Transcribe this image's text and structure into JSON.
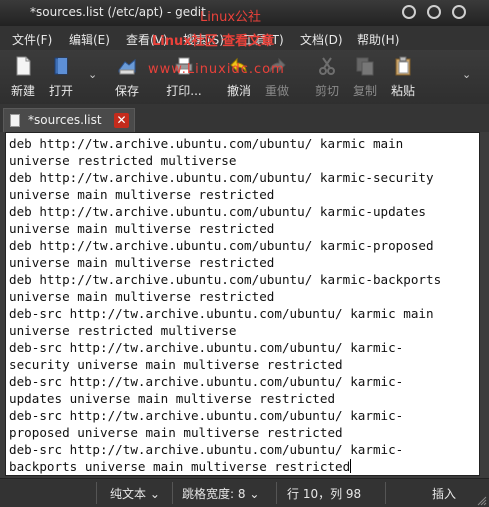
{
  "window": {
    "title": "*sources.list (/etc/apt) - gedit",
    "title_watermark": "Linux公社"
  },
  "menu": {
    "items": [
      "文件(F)",
      "编辑(E)",
      "查看(V)",
      "搜索(S)",
      "工具(T)",
      "文档(D)",
      "帮助(H)"
    ],
    "watermark": "Linux社区 查看文章"
  },
  "toolbar": {
    "new_label": "新建",
    "open_label": "打开",
    "save_label": "保存",
    "print_label": "打印...",
    "undo_label": "撤消",
    "redo_label": "重做",
    "cut_label": "剪切",
    "copy_label": "复制",
    "paste_label": "粘贴",
    "dropdown_glyph": "⌄",
    "watermark": "www.Linuxidc.com"
  },
  "tab": {
    "label": "*sources.list",
    "close_glyph": "✕"
  },
  "editor": {
    "lines": [
      "deb http://tw.archive.ubuntu.com/ubuntu/ karmic main",
      "universe restricted multiverse",
      "deb http://tw.archive.ubuntu.com/ubuntu/ karmic-security",
      "universe main multiverse restricted",
      "deb http://tw.archive.ubuntu.com/ubuntu/ karmic-updates",
      "universe main multiverse restricted",
      "deb http://tw.archive.ubuntu.com/ubuntu/ karmic-proposed",
      "universe main multiverse restricted",
      "deb http://tw.archive.ubuntu.com/ubuntu/ karmic-backports",
      "universe main multiverse restricted",
      "deb-src http://tw.archive.ubuntu.com/ubuntu/ karmic main",
      "universe restricted multiverse",
      "deb-src http://tw.archive.ubuntu.com/ubuntu/ karmic-",
      "security universe main multiverse restricted",
      "deb-src http://tw.archive.ubuntu.com/ubuntu/ karmic-",
      "updates universe main multiverse restricted",
      "deb-src http://tw.archive.ubuntu.com/ubuntu/ karmic-",
      "proposed universe main multiverse restricted",
      "deb-src http://tw.archive.ubuntu.com/ubuntu/ karmic-",
      "backports universe main multiverse restricted"
    ]
  },
  "status": {
    "syntax": "纯文本",
    "tab_width": "跳格宽度: 8",
    "position": "行 10，列 98",
    "mode": "插入",
    "dropdown_glyph": "⌄"
  },
  "colors": {
    "watermark": "#e8413a",
    "tab_close": "#c42b1c",
    "editor_bg": "#ffffff"
  },
  "icons": [
    "new-document-icon",
    "open-folder-icon",
    "save-icon",
    "print-icon",
    "undo-icon",
    "redo-icon",
    "cut-icon",
    "copy-icon",
    "paste-icon"
  ]
}
